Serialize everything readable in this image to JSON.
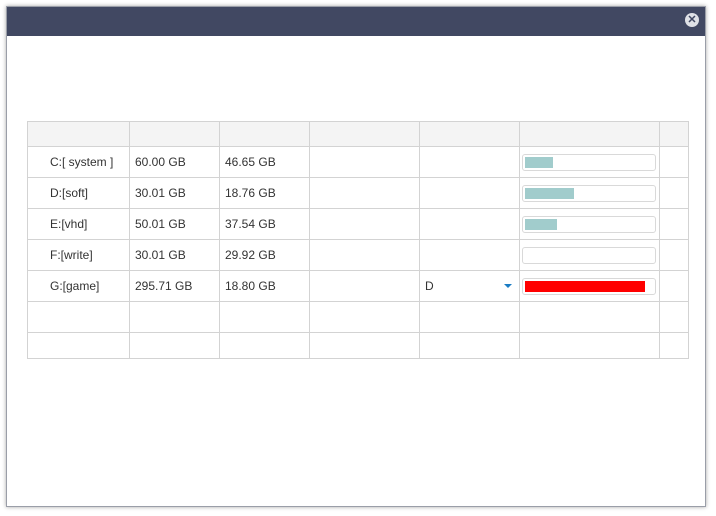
{
  "window": {
    "close_icon": "close-icon"
  },
  "drives": [
    {
      "name": "C:[ system ]",
      "total": "60.00 GB",
      "free": "46.65 GB",
      "mapped": "",
      "usage": 0.22,
      "bar_color": "#a1cccc"
    },
    {
      "name": "D:[soft]",
      "total": "30.01 GB",
      "free": "18.76 GB",
      "mapped": "",
      "usage": 0.38,
      "bar_color": "#a1cccc"
    },
    {
      "name": "E:[vhd]",
      "total": "50.01 GB",
      "free": "37.54 GB",
      "mapped": "",
      "usage": 0.25,
      "bar_color": "#a1cccc"
    },
    {
      "name": "F:[write]",
      "total": "30.01 GB",
      "free": "29.92 GB",
      "mapped": "",
      "usage": 0.0,
      "bar_color": "#a1cccc"
    },
    {
      "name": "G:[game]",
      "total": "295.71 GB",
      "free": "18.80 GB",
      "mapped": "D",
      "usage": 0.94,
      "bar_color": "#ff0000"
    }
  ],
  "colors": {
    "titlebar": "#414862",
    "bar_normal": "#a1cccc",
    "bar_critical": "#ff0000",
    "dropdown_caret": "#1a7cc4"
  }
}
